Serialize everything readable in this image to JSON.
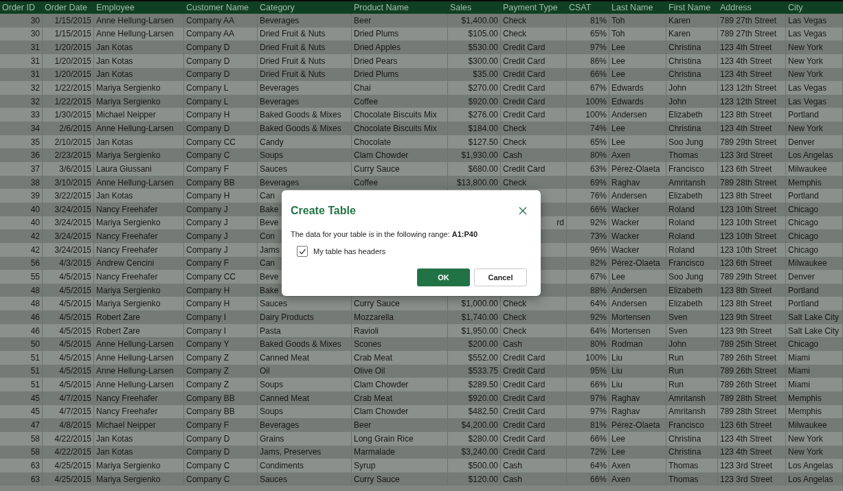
{
  "table": {
    "columns": [
      "Order ID",
      "Order Date",
      "Employee",
      "Customer Name",
      "Category",
      "Product Name",
      "Sales",
      "Payment Type",
      "CSAT",
      "Last Name",
      "First Name",
      "Address",
      "City"
    ],
    "rows": [
      {
        "cells": [
          "30",
          "1/15/2015",
          "Anne Hellung-Larsen",
          "Company AA",
          "Beverages",
          "Beer",
          "$1,400.00",
          "Check",
          "81%",
          "Toh",
          "Karen",
          "789 27th Street",
          "Las Vegas"
        ]
      },
      {
        "cells": [
          "30",
          "1/15/2015",
          "Anne Hellung-Larsen",
          "Company AA",
          "Dried Fruit & Nuts",
          "Dried Plums",
          "$105.00",
          "Check",
          "65%",
          "Toh",
          "Karen",
          "789 27th Street",
          "Las Vegas"
        ]
      },
      {
        "cells": [
          "31",
          "1/20/2015",
          "Jan Kotas",
          "Company D",
          "Dried Fruit & Nuts",
          "Dried Apples",
          "$530.00",
          "Credit Card",
          "97%",
          "Lee",
          "Christina",
          "123 4th Street",
          "New York"
        ]
      },
      {
        "cells": [
          "31",
          "1/20/2015",
          "Jan Kotas",
          "Company D",
          "Dried Fruit & Nuts",
          "Dried Pears",
          "$300.00",
          "Credit Card",
          "86%",
          "Lee",
          "Christina",
          "123 4th Street",
          "New York"
        ]
      },
      {
        "cells": [
          "31",
          "1/20/2015",
          "Jan Kotas",
          "Company D",
          "Dried Fruit & Nuts",
          "Dried Plums",
          "$35.00",
          "Credit Card",
          "66%",
          "Lee",
          "Christina",
          "123 4th Street",
          "New York"
        ]
      },
      {
        "cells": [
          "32",
          "1/22/2015",
          "Mariya Sergienko",
          "Company L",
          "Beverages",
          "Chai",
          "$270.00",
          "Credit Card",
          "67%",
          "Edwards",
          "John",
          "123 12th Street",
          "Las Vegas"
        ]
      },
      {
        "cells": [
          "32",
          "1/22/2015",
          "Mariya Sergienko",
          "Company L",
          "Beverages",
          "Coffee",
          "$920.00",
          "Credit Card",
          "100%",
          "Edwards",
          "John",
          "123 12th Street",
          "Las Vegas"
        ]
      },
      {
        "cells": [
          "33",
          "1/30/2015",
          "Michael Neipper",
          "Company H",
          "Baked Goods & Mixes",
          "Chocolate Biscuits Mix",
          "$276.00",
          "Credit Card",
          "100%",
          "Andersen",
          "Elizabeth",
          "123 8th Street",
          "Portland"
        ]
      },
      {
        "cells": [
          "34",
          "2/6/2015",
          "Anne Hellung-Larsen",
          "Company D",
          "Baked Goods & Mixes",
          "Chocolate Biscuits Mix",
          "$184.00",
          "Check",
          "74%",
          "Lee",
          "Christina",
          "123 4th Street",
          "New York"
        ]
      },
      {
        "cells": [
          "35",
          "2/10/2015",
          "Jan Kotas",
          "Company CC",
          "Candy",
          "Chocolate",
          "$127.50",
          "Check",
          "65%",
          "Lee",
          "Soo Jung",
          "789 29th Street",
          "Denver"
        ]
      },
      {
        "cells": [
          "36",
          "2/23/2015",
          "Mariya Sergienko",
          "Company C",
          "Soups",
          "Clam Chowder",
          "$1,930.00",
          "Cash",
          "80%",
          "Axen",
          "Thomas",
          "123 3rd Street",
          "Los Angelas"
        ]
      },
      {
        "cells": [
          "37",
          "3/6/2015",
          "Laura Giussani",
          "Company F",
          "Sauces",
          "Curry Sauce",
          "$680.00",
          "Credit Card",
          "63%",
          "Pérez-Olaeta",
          "Francisco",
          "123 6th Street",
          "Milwaukee"
        ]
      },
      {
        "cells": [
          "38",
          "3/10/2015",
          "Anne Hellung-Larsen",
          "Company BB",
          "Beverages",
          "Coffee",
          "$13,800.00",
          "Check",
          "69%",
          "Raghav",
          "Amritansh",
          "789 28th Street",
          "Memphis"
        ]
      },
      {
        "cells": [
          "39",
          "3/22/2015",
          "Jan Kotas",
          "Company H",
          "Can",
          null,
          null,
          null,
          "76%",
          "Andersen",
          "Elizabeth",
          "123 8th Street",
          "Portland"
        ]
      },
      {
        "cells": [
          "40",
          "3/24/2015",
          "Nancy Freehafer",
          "Company J",
          "Bake",
          null,
          null,
          null,
          "66%",
          "Wacker",
          "Roland",
          "123 10th Street",
          "Chicago"
        ]
      },
      {
        "cells": [
          "40",
          "3/24/2015",
          "Mariya Sergienko",
          "Company J",
          "Beve",
          null,
          null,
          "rd",
          "92%",
          "Wacker",
          "Roland",
          "123 10th Street",
          "Chicago"
        ]
      },
      {
        "cells": [
          "42",
          "3/24/2015",
          "Nancy Freehafer",
          "Company J",
          "Con",
          null,
          null,
          null,
          "73%",
          "Wacker",
          "Roland",
          "123 10th Street",
          "Chicago"
        ]
      },
      {
        "cells": [
          "42",
          "3/24/2015",
          "Nancy Freehafer",
          "Company J",
          "Jams",
          null,
          null,
          null,
          "96%",
          "Wacker",
          "Roland",
          "123 10th Street",
          "Chicago"
        ]
      },
      {
        "cells": [
          "56",
          "4/3/2015",
          "Andrew Cencini",
          "Company F",
          "Can",
          null,
          null,
          null,
          "82%",
          "Pérez-Olaeta",
          "Francisco",
          "123 6th Street",
          "Milwaukee"
        ]
      },
      {
        "cells": [
          "55",
          "4/5/2015",
          "Nancy Freehafer",
          "Company CC",
          "Beve",
          null,
          null,
          null,
          "67%",
          "Lee",
          "Soo Jung",
          "789 29th Street",
          "Denver"
        ]
      },
      {
        "cells": [
          "48",
          "4/5/2015",
          "Mariya Sergienko",
          "Company H",
          "Bake",
          null,
          null,
          null,
          "88%",
          "Andersen",
          "Elizabeth",
          "123 8th Street",
          "Portland"
        ]
      },
      {
        "cells": [
          "48",
          "4/5/2015",
          "Mariya Sergienko",
          "Company H",
          "Sauces",
          "Curry Sauce",
          "$1,000.00",
          "Check",
          "64%",
          "Andersen",
          "Elizabeth",
          "123 8th Street",
          "Portland"
        ]
      },
      {
        "cells": [
          "46",
          "4/5/2015",
          "Robert Zare",
          "Company I",
          "Dairy Products",
          "Mozzarella",
          "$1,740.00",
          "Check",
          "92%",
          "Mortensen",
          "Sven",
          "123 9th Street",
          "Salt Lake City"
        ]
      },
      {
        "cells": [
          "46",
          "4/5/2015",
          "Robert Zare",
          "Company I",
          "Pasta",
          "Ravioli",
          "$1,950.00",
          "Check",
          "64%",
          "Mortensen",
          "Sven",
          "123 9th Street",
          "Salt Lake City"
        ]
      },
      {
        "cells": [
          "50",
          "4/5/2015",
          "Anne Hellung-Larsen",
          "Company Y",
          "Baked Goods & Mixes",
          "Scones",
          "$200.00",
          "Cash",
          "80%",
          "Rodman",
          "John",
          "789 25th Street",
          "Chicago"
        ]
      },
      {
        "cells": [
          "51",
          "4/5/2015",
          "Anne Hellung-Larsen",
          "Company Z",
          "Canned Meat",
          "Crab Meat",
          "$552.00",
          "Credit Card",
          "100%",
          "Liu",
          "Run",
          "789 26th Street",
          "Miami"
        ]
      },
      {
        "cells": [
          "51",
          "4/5/2015",
          "Anne Hellung-Larsen",
          "Company Z",
          "Oil",
          "Olive Oil",
          "$533.75",
          "Credit Card",
          "95%",
          "Liu",
          "Run",
          "789 26th Street",
          "Miami"
        ]
      },
      {
        "cells": [
          "51",
          "4/5/2015",
          "Anne Hellung-Larsen",
          "Company Z",
          "Soups",
          "Clam Chowder",
          "$289.50",
          "Credit Card",
          "66%",
          "Liu",
          "Run",
          "789 26th Street",
          "Miami"
        ]
      },
      {
        "cells": [
          "45",
          "4/7/2015",
          "Nancy Freehafer",
          "Company BB",
          "Canned Meat",
          "Crab Meat",
          "$920.00",
          "Credit Card",
          "97%",
          "Raghav",
          "Amritansh",
          "789 28th Street",
          "Memphis"
        ]
      },
      {
        "cells": [
          "45",
          "4/7/2015",
          "Nancy Freehafer",
          "Company BB",
          "Soups",
          "Clam Chowder",
          "$482.50",
          "Credit Card",
          "97%",
          "Raghav",
          "Amritansh",
          "789 28th Street",
          "Memphis"
        ]
      },
      {
        "cells": [
          "47",
          "4/8/2015",
          "Michael Neipper",
          "Company F",
          "Beverages",
          "Beer",
          "$4,200.00",
          "Credit Card",
          "81%",
          "Pérez-Olaeta",
          "Francisco",
          "123 6th Street",
          "Milwaukee"
        ]
      },
      {
        "cells": [
          "58",
          "4/22/2015",
          "Jan Kotas",
          "Company D",
          "Grains",
          "Long Grain Rice",
          "$280.00",
          "Credit Card",
          "66%",
          "Lee",
          "Christina",
          "123 4th Street",
          "New York"
        ]
      },
      {
        "cells": [
          "58",
          "4/22/2015",
          "Jan Kotas",
          "Company D",
          "Jams, Preserves",
          "Marmalade",
          "$3,240.00",
          "Credit Card",
          "72%",
          "Lee",
          "Christina",
          "123 4th Street",
          "New York"
        ]
      },
      {
        "cells": [
          "63",
          "4/25/2015",
          "Mariya Sergienko",
          "Company C",
          "Condiments",
          "Syrup",
          "$500.00",
          "Cash",
          "64%",
          "Axen",
          "Thomas",
          "123 3rd Street",
          "Los Angelas"
        ]
      },
      {
        "cells": [
          "63",
          "4/25/2015",
          "Mariya Sergienko",
          "Company C",
          "Sauces",
          "Curry Sauce",
          "$120.00",
          "Cash",
          "66%",
          "Axen",
          "Thomas",
          "123 3rd Street",
          "Los Angelas"
        ]
      }
    ]
  },
  "dialog": {
    "title": "Create Table",
    "message": "The data for your table is in the following range: **A1:P40**",
    "checkbox": {
      "label": "My table has headers",
      "checked": true
    },
    "buttons": [
      {
        "label": "OK",
        "kind": "primary"
      },
      {
        "label": "Cancel",
        "kind": "secondary"
      }
    ]
  }
}
